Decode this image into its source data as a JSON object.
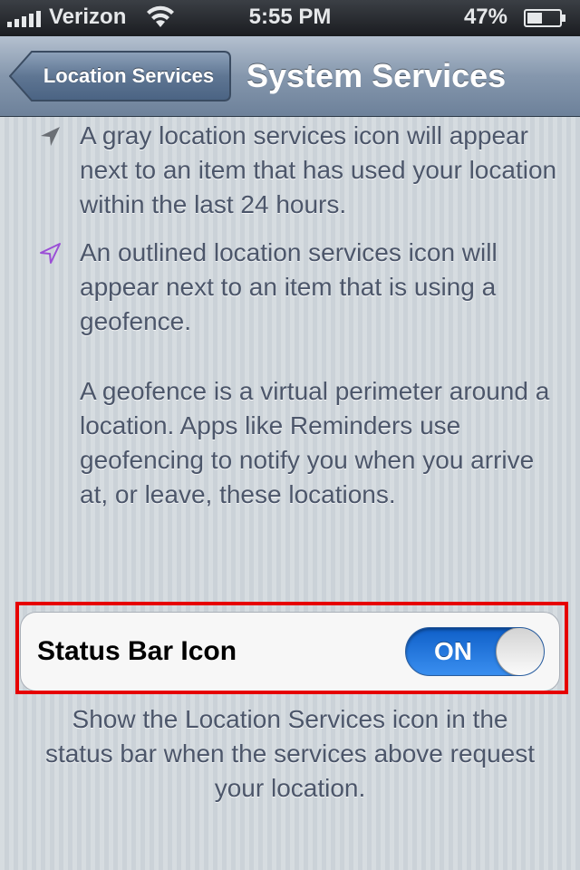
{
  "status_bar": {
    "carrier": "Verizon",
    "time": "5:55 PM",
    "battery": "47%",
    "battery_level": 0.47
  },
  "nav": {
    "back_label": "Location Services",
    "title": "System Services"
  },
  "legend": {
    "gray_icon_text": "A gray location services icon will appear next to an item that has used your location within the last 24 hours.",
    "outlined_icon_text": "An outlined location services icon will appear next to an item that is using a geofence.",
    "geofence_text": "A geofence is a virtual perimeter around a location. Apps like Reminders use geofencing to notify you when you arrive at, or leave, these locations."
  },
  "status_bar_icon_setting": {
    "label": "Status Bar Icon",
    "toggle_state": "ON",
    "footer": "Show the Location Services icon in the status bar when the services above request your location."
  },
  "colors": {
    "highlight": "#e60000",
    "toggle_on": "#1e73d8",
    "gray_arrow": "#6b6f75",
    "outlined_arrow": "#9b4fd6"
  },
  "icons": [
    "signal-bars-icon",
    "wifi-icon",
    "battery-icon",
    "back-chevron-icon",
    "location-arrow-gray-icon",
    "location-arrow-outline-icon"
  ]
}
